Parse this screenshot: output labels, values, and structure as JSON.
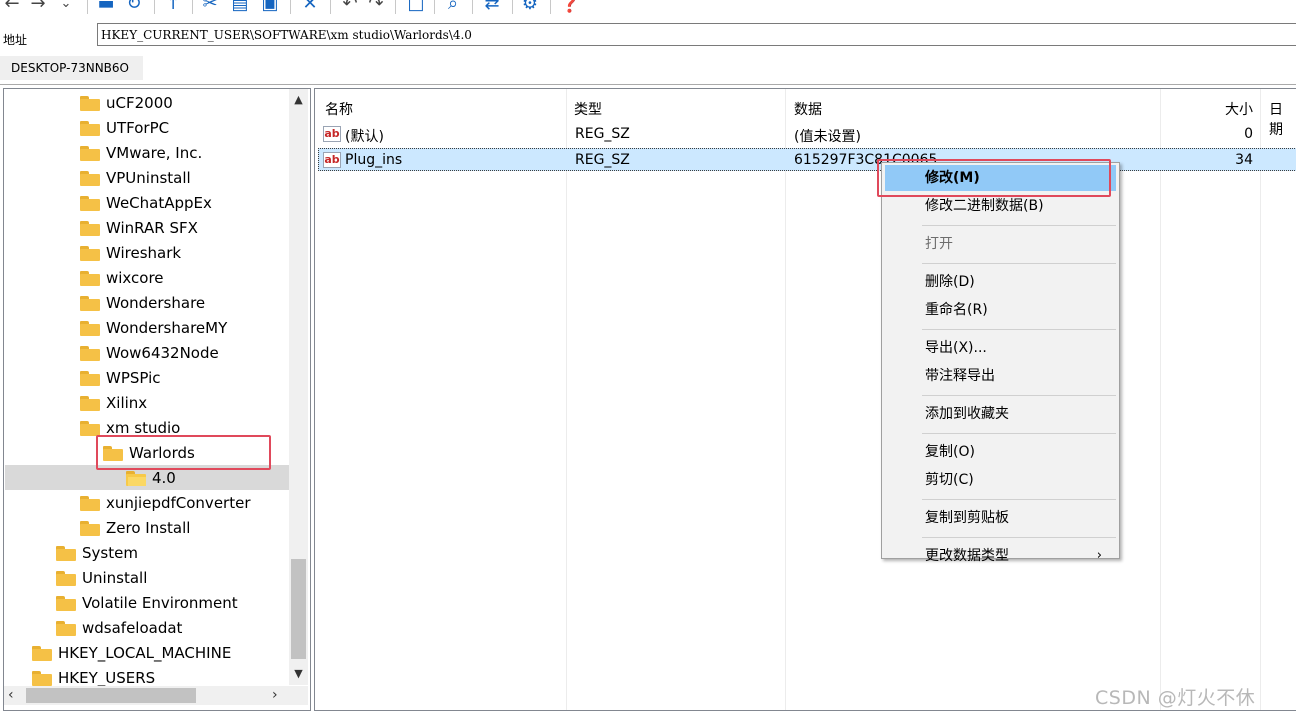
{
  "toolbar": {
    "icons": [
      "back-arrow-icon",
      "forward-arrow-icon",
      "dropdown-icon",
      "computer-icon",
      "refresh-icon",
      "up-arrow-icon",
      "cut-icon",
      "copy-icon",
      "export-icon",
      "delete-icon",
      "undo-icon",
      "redo-icon",
      "new-key-icon",
      "find-icon",
      "jump-icon",
      "settings-icon",
      "help-icon"
    ]
  },
  "address": {
    "label": "地址",
    "value": "HKEY_CURRENT_USER\\SOFTWARE\\xm studio\\Warlords\\4.0"
  },
  "computer_tab": {
    "label": "DESKTOP-73NNB6O"
  },
  "tree": {
    "items": [
      {
        "label": "uCF2000",
        "depth": 3
      },
      {
        "label": "UTForPC",
        "depth": 3
      },
      {
        "label": "VMware, Inc.",
        "depth": 3
      },
      {
        "label": "VPUninstall",
        "depth": 3
      },
      {
        "label": "WeChatAppEx",
        "depth": 3
      },
      {
        "label": "WinRAR SFX",
        "depth": 3
      },
      {
        "label": "Wireshark",
        "depth": 3
      },
      {
        "label": "wixcore",
        "depth": 3
      },
      {
        "label": "Wondershare",
        "depth": 3
      },
      {
        "label": "WondershareMY",
        "depth": 3
      },
      {
        "label": "Wow6432Node",
        "depth": 3
      },
      {
        "label": "WPSPic",
        "depth": 3
      },
      {
        "label": "Xilinx",
        "depth": 3
      },
      {
        "label": "xm studio",
        "depth": 3
      },
      {
        "label": "Warlords",
        "depth": 4
      },
      {
        "label": "4.0",
        "depth": 5,
        "selected": true
      },
      {
        "label": "xunjiepdfConverter",
        "depth": 3
      },
      {
        "label": "Zero Install",
        "depth": 3
      },
      {
        "label": "System",
        "depth": 2
      },
      {
        "label": "Uninstall",
        "depth": 2
      },
      {
        "label": "Volatile Environment",
        "depth": 2
      },
      {
        "label": "wdsafeloadat",
        "depth": 2
      },
      {
        "label": "HKEY_LOCAL_MACHINE",
        "depth": 1
      },
      {
        "label": "HKEY_USERS",
        "depth": 1
      }
    ]
  },
  "list": {
    "headers": {
      "name": "名称",
      "type": "类型",
      "data": "数据",
      "size": "大小",
      "date": "日期"
    },
    "rows": [
      {
        "name": "(默认)",
        "type": "REG_SZ",
        "data": "(值未设置)",
        "size": "0",
        "icon": "ab"
      },
      {
        "name": "Plug_ins",
        "type": "REG_SZ",
        "data": "615297F3C81C0065",
        "size": "34",
        "icon": "ab"
      }
    ]
  },
  "context_menu": {
    "items": [
      {
        "label": "修改(M)",
        "state": "active"
      },
      {
        "label": "修改二进制数据(B)"
      },
      {
        "sep": true
      },
      {
        "label": "打开",
        "state": "disabled"
      },
      {
        "sep": true
      },
      {
        "label": "删除(D)"
      },
      {
        "label": "重命名(R)"
      },
      {
        "sep": true
      },
      {
        "label": "导出(X)..."
      },
      {
        "label": "带注释导出"
      },
      {
        "sep": true
      },
      {
        "label": "添加到收藏夹"
      },
      {
        "sep": true
      },
      {
        "label": "复制(O)"
      },
      {
        "label": "剪切(C)"
      },
      {
        "sep": true
      },
      {
        "label": "复制到剪贴板"
      },
      {
        "sep": true
      },
      {
        "label": "更改数据类型",
        "submenu": true
      }
    ]
  },
  "watermark": "CSDN @灯火不休",
  "colors": {
    "highlight": "#e0495b",
    "selected_row": "#cce8ff",
    "menu_active": "#91c9f7",
    "folder": "#f5c146"
  }
}
